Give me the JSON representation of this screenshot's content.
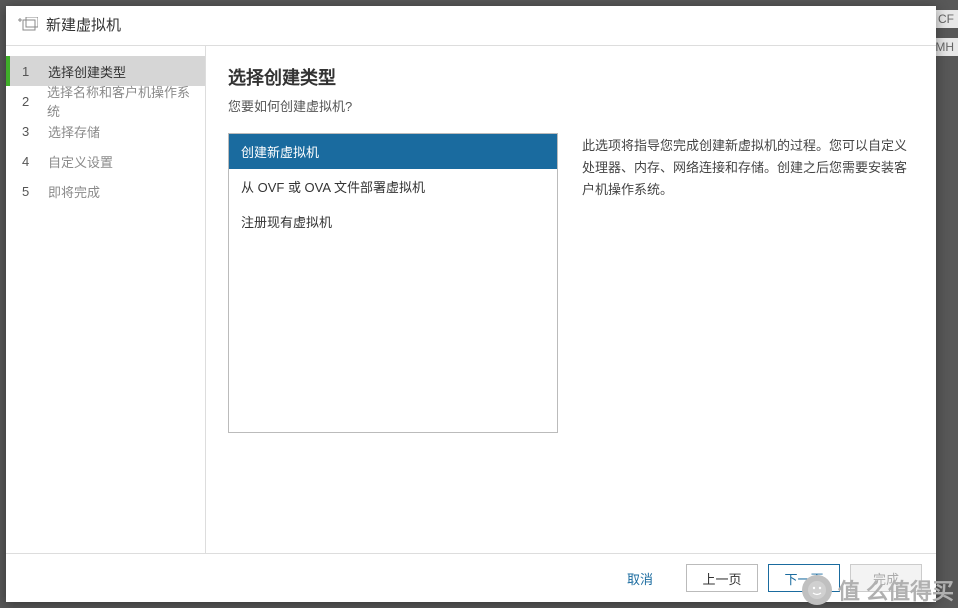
{
  "background": {
    "frag1": "CF",
    "frag2": "MH"
  },
  "dialog": {
    "title": "新建虚拟机",
    "steps": [
      {
        "num": "1",
        "label": "选择创建类型"
      },
      {
        "num": "2",
        "label": "选择名称和客户机操作系统"
      },
      {
        "num": "3",
        "label": "选择存储"
      },
      {
        "num": "4",
        "label": "自定义设置"
      },
      {
        "num": "5",
        "label": "即将完成"
      }
    ],
    "content": {
      "title": "选择创建类型",
      "subtitle": "您要如何创建虚拟机?",
      "options": [
        "创建新虚拟机",
        "从 OVF 或 OVA 文件部署虚拟机",
        "注册现有虚拟机"
      ],
      "description": "此选项将指导您完成创建新虚拟机的过程。您可以自定义处理器、内存、网络连接和存储。创建之后您需要安装客户机操作系统。"
    },
    "footer": {
      "cancel": "取消",
      "back": "上一页",
      "next": "下一页",
      "finish": "完成"
    }
  },
  "watermark": {
    "text": "值 么值得买"
  }
}
